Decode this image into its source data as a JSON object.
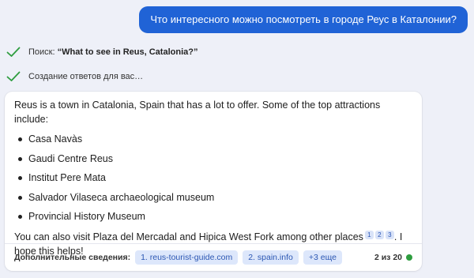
{
  "user_message": "Что интересного можно посмотреть в городе Реус в Каталонии?",
  "progress": {
    "search_label": "Поиск:",
    "search_query": "“What to see in Reus, Catalonia?”",
    "generating_label": "Создание ответов для вас…"
  },
  "answer": {
    "intro": "Reus is a town in Catalonia, Spain that has a lot to offer. Some of the top attractions include:",
    "attractions": [
      "Casa Navàs",
      "Gaudi Centre Reus",
      "Institut Pere Mata",
      "Salvador Vilaseca archaeological museum",
      "Provincial History Museum"
    ],
    "closing_before_cites": "You can also visit Plaza del Mercadal and Hipica West Fork among other places",
    "citations": [
      "1",
      "2",
      "3"
    ],
    "closing_after_cites": ". I hope this helps!"
  },
  "footer": {
    "learn_more_label": "Дополнительные сведения:",
    "sources": [
      "1. reus-tourist-guide.com",
      "2. spain.info"
    ],
    "more_label": "+3 еще",
    "counter": "2 из 20"
  },
  "colors": {
    "accent": "#2063d6",
    "check": "#2e9d3f",
    "status_dot": "#2e9d3f",
    "chip_bg": "#dde7fb"
  },
  "icons": {
    "progress_check": "check-icon",
    "status": "status-dot-icon"
  }
}
